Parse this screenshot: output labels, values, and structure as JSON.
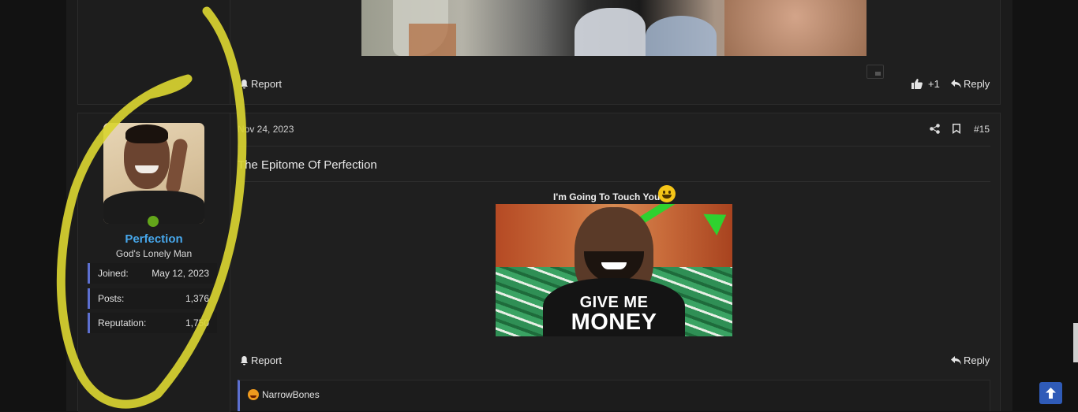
{
  "previous_post": {
    "actions": {
      "report_label": "Report",
      "like_count": "+1",
      "reply_label": "Reply"
    }
  },
  "post": {
    "date": "Nov 24, 2023",
    "post_number": "#15",
    "title": "The Epitome Of Perfection",
    "caption": "I'm Going To Touch You",
    "thumbnail": {
      "line1": "GIVE ME",
      "line2": "MONEY"
    },
    "actions": {
      "report_label": "Report",
      "reply_label": "Reply"
    },
    "quote": {
      "author": "NarrowBones"
    },
    "icons": [
      "share-icon",
      "bookmark-icon",
      "bell-icon",
      "reply-arrow-icon",
      "thumbs-up-icon"
    ]
  },
  "user": {
    "name": "Perfection",
    "title": "God's Lonely Man",
    "online": true,
    "stats": [
      {
        "label": "Joined:",
        "value": "May 12, 2023"
      },
      {
        "label": "Posts:",
        "value": "1,376"
      },
      {
        "label": "Reputation:",
        "value": "1,750"
      }
    ]
  },
  "colors": {
    "username": "#47a7eb",
    "accent": "#5c6fcf",
    "online": "#63a61a",
    "scroll_top_button": "#2f5bb8",
    "annotation": "#d9d431"
  }
}
